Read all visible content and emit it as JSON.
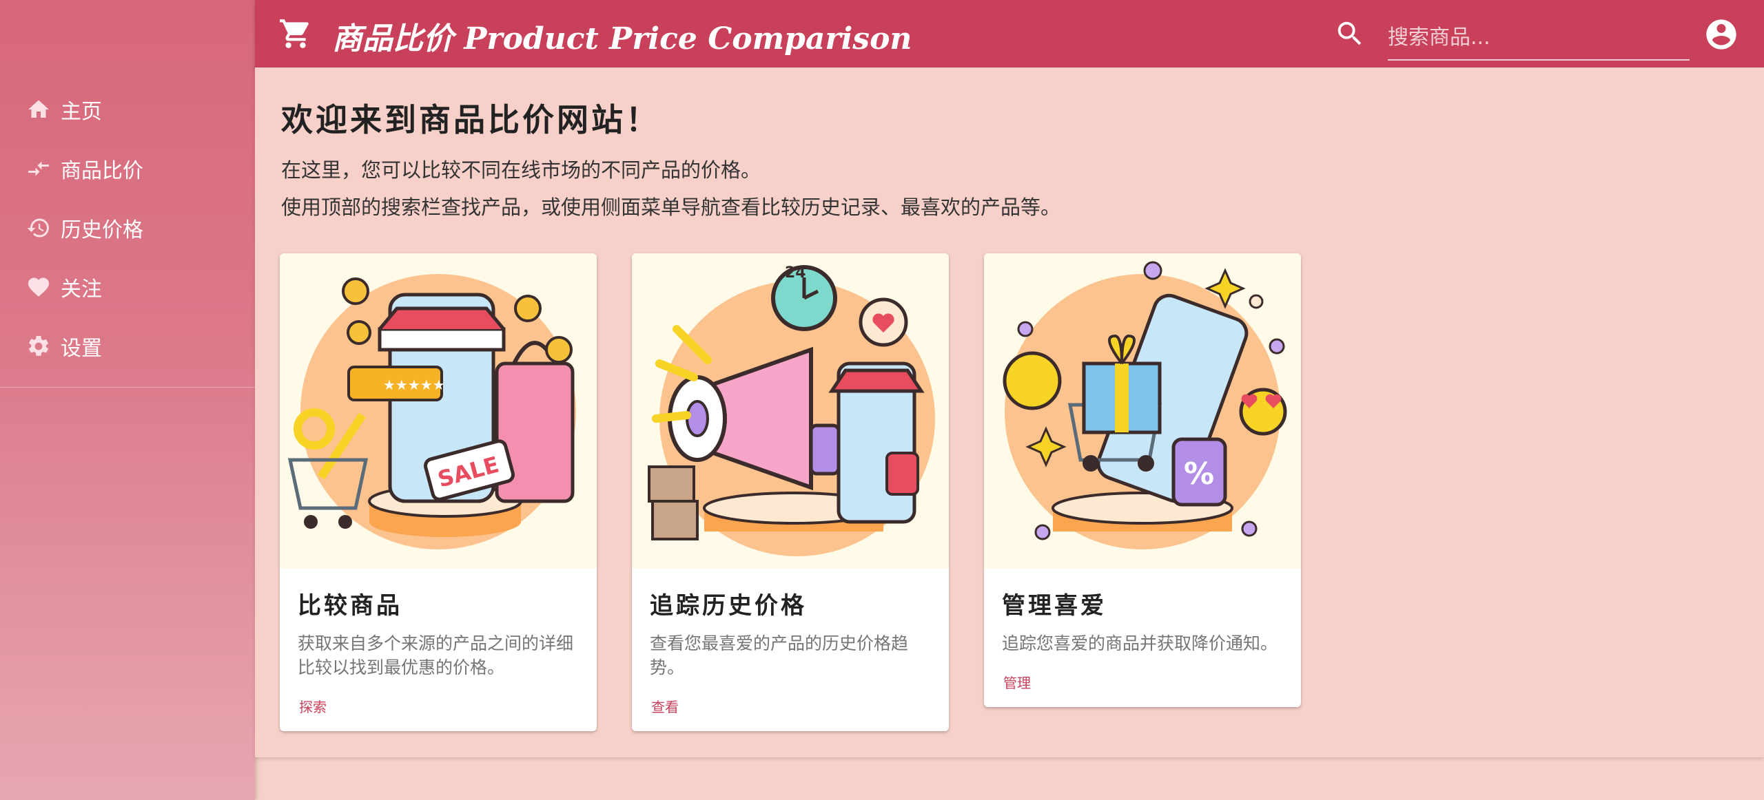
{
  "header": {
    "title": "商品比价 Product Price Comparison",
    "search_placeholder": "搜索商品..."
  },
  "sidebar": {
    "items": [
      {
        "label": "主页",
        "icon": "home-icon"
      },
      {
        "label": "商品比价",
        "icon": "compare-arrows-icon"
      },
      {
        "label": "历史价格",
        "icon": "history-icon"
      },
      {
        "label": "关注",
        "icon": "heart-icon"
      },
      {
        "label": "设置",
        "icon": "gear-icon"
      }
    ]
  },
  "main": {
    "welcome_title": "欢迎来到商品比价网站！",
    "intro_line1": "在这里，您可以比较不同在线市场的不同产品的价格。",
    "intro_line2": "使用顶部的搜索栏查找产品，或使用侧面菜单导航查看比较历史记录、最喜欢的产品等。"
  },
  "cards": [
    {
      "title": "比较商品",
      "description": "获取来自多个来源的产品之间的详细比较以找到最优惠的价格。",
      "action": "探索",
      "art_text": "SALE"
    },
    {
      "title": "追踪历史价格",
      "description": "查看您最喜爱的产品的历史价格趋势。",
      "action": "查看",
      "art_text": "24"
    },
    {
      "title": "管理喜爱",
      "description": "追踪您喜爱的商品并获取降价通知。",
      "action": "管理"
    }
  ],
  "colors": {
    "primary": "#c8405a",
    "background": "#f7d1c9",
    "sidebar_top": "#d7677a",
    "sidebar_bottom": "#e7a7b2"
  }
}
